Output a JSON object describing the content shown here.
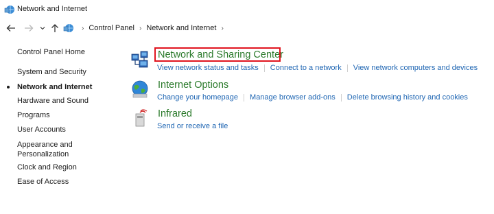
{
  "window": {
    "title": "Network and Internet"
  },
  "breadcrumb": [
    "Control Panel",
    "Network and Internet"
  ],
  "sidebar": {
    "items": [
      {
        "label": "Control Panel Home"
      },
      {
        "label": "System and Security"
      },
      {
        "label": "Network and Internet",
        "active": true
      },
      {
        "label": "Hardware and Sound"
      },
      {
        "label": "Programs"
      },
      {
        "label": "User Accounts"
      },
      {
        "label": "Appearance and"
      },
      {
        "label": "Personalization"
      },
      {
        "label": "Clock and Region"
      },
      {
        "label": "Ease of Access"
      }
    ]
  },
  "categories": [
    {
      "title": "Network and Sharing Center",
      "icon": "network-sharing-icon",
      "links": [
        "View network status and tasks",
        "Connect to a network",
        "View network computers and devices"
      ]
    },
    {
      "title": "Internet Options",
      "icon": "internet-globe-icon",
      "links": [
        "Change your homepage",
        "Manage browser add-ons",
        "Delete browsing history and cookies"
      ]
    },
    {
      "title": "Infrared",
      "icon": "infrared-icon",
      "links": [
        "Send or receive a file"
      ]
    }
  ],
  "colors": {
    "category_title": "#2b7a2b",
    "link": "#1f66b3",
    "highlight_border": "#e0141e"
  }
}
